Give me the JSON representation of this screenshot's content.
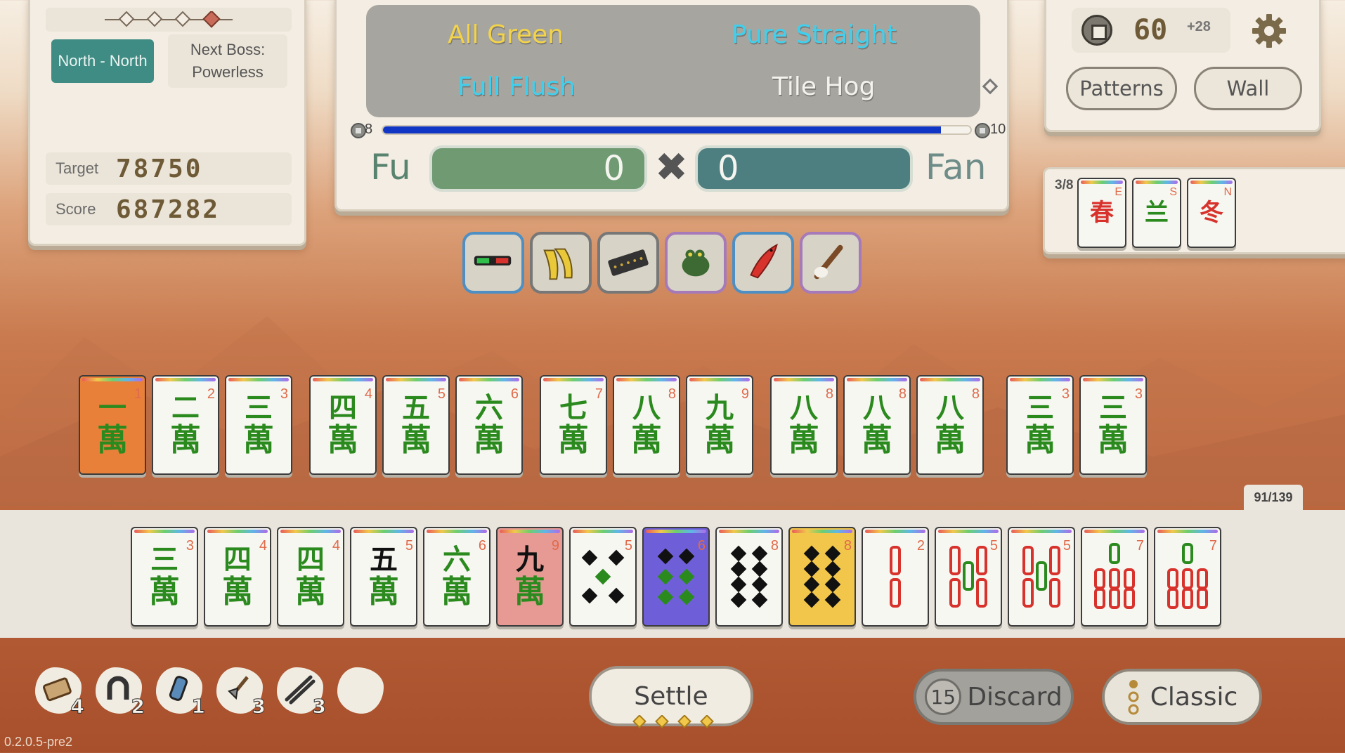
{
  "round": {
    "wind": "North - North",
    "boss_label": "Next Boss:",
    "boss_name": "Powerless",
    "target_label": "Target",
    "target_value": "78750",
    "score_label": "Score",
    "score_value": "687282"
  },
  "yaku": [
    {
      "name": "All Green",
      "color": "#f2d34a"
    },
    {
      "name": "Pure Straight",
      "color": "#3fd0ee"
    },
    {
      "name": "Full Flush",
      "color": "#3fd0ee"
    },
    {
      "name": "Tile Hog",
      "color": "#f4f2ec"
    }
  ],
  "progress": {
    "min_label": "8",
    "max_label": "10",
    "fraction": 0.95,
    "fill_color": "#1136c6"
  },
  "scoring": {
    "fu_label": "Fu",
    "fu_value": "0",
    "times_symbol": "✖",
    "fan_value": "0",
    "fan_label": "Fan",
    "fu_color": "#6f9a72",
    "fan_color": "#4d7f80"
  },
  "wallet": {
    "money": "60",
    "money_plus": "+28",
    "settings_icon": "gear-icon",
    "patterns_label": "Patterns",
    "wall_label": "Wall"
  },
  "flowers": {
    "count": "3/8",
    "tiles": [
      {
        "glyph": "春",
        "corner": "E",
        "icon": "flower-spring-icon"
      },
      {
        "glyph": "兰",
        "corner": "S",
        "icon": "flower-orchid-icon"
      },
      {
        "glyph": "冬",
        "corner": "N",
        "icon": "flower-winter-icon"
      }
    ]
  },
  "relics": [
    {
      "icon": "3d-glasses-icon",
      "border": "#4e8fc3"
    },
    {
      "icon": "banana-peel-icon",
      "border": "#777777"
    },
    {
      "icon": "abacus-icon",
      "border": "#777777"
    },
    {
      "icon": "frog-icon",
      "border": "#a67ab8"
    },
    {
      "icon": "red-fish-icon",
      "border": "#4e8fc3"
    },
    {
      "icon": "brush-icon",
      "border": "#a67ab8"
    }
  ],
  "melds": [
    {
      "char": "一",
      "num": "1",
      "bg": "#e8803a"
    },
    {
      "char": "二",
      "num": "2"
    },
    {
      "char": "三",
      "num": "3"
    },
    {
      "char": "四",
      "num": "4"
    },
    {
      "char": "五",
      "num": "5"
    },
    {
      "char": "六",
      "num": "6"
    },
    {
      "char": "七",
      "num": "7"
    },
    {
      "char": "八",
      "num": "8"
    },
    {
      "char": "九",
      "num": "9"
    },
    {
      "char": "八",
      "num": "8"
    },
    {
      "char": "八",
      "num": "8"
    },
    {
      "char": "八",
      "num": "8"
    },
    {
      "char": "三",
      "num": "3"
    },
    {
      "char": "三",
      "num": "3"
    }
  ],
  "wall_count": "91/139",
  "hand": [
    {
      "kind": "wan",
      "char": "三",
      "num": "3"
    },
    {
      "kind": "wan",
      "char": "四",
      "num": "4"
    },
    {
      "kind": "wan",
      "char": "四",
      "num": "4"
    },
    {
      "kind": "wan",
      "char": "五",
      "num": "5",
      "ink": "#111111"
    },
    {
      "kind": "wan",
      "char": "六",
      "num": "6"
    },
    {
      "kind": "wan",
      "char": "九",
      "num": "9",
      "bg": "#e79a94",
      "ink": "#111111"
    },
    {
      "kind": "circle",
      "num": "5"
    },
    {
      "kind": "circle",
      "num": "6",
      "bg": "#6e5fd8"
    },
    {
      "kind": "circle",
      "num": "8"
    },
    {
      "kind": "circle",
      "num": "8",
      "bg": "#f1c64a"
    },
    {
      "kind": "bamboo",
      "num": "2"
    },
    {
      "kind": "bamboo",
      "num": "5"
    },
    {
      "kind": "bamboo",
      "num": "5"
    },
    {
      "kind": "bamboo",
      "num": "7"
    },
    {
      "kind": "bamboo",
      "num": "7"
    }
  ],
  "tools": [
    {
      "icon": "scroll-icon",
      "count": "4"
    },
    {
      "icon": "horseshoe-icon",
      "count": "2"
    },
    {
      "icon": "bottle-icon",
      "count": "1"
    },
    {
      "icon": "shovel-icon",
      "count": "3"
    },
    {
      "icon": "tongs-icon",
      "count": "3"
    },
    {
      "icon": "empty-slot-icon",
      "count": ""
    }
  ],
  "actions": {
    "settle_label": "Settle",
    "discard_count": "15",
    "discard_label": "Discard",
    "classic_label": "Classic"
  },
  "version": "0.2.0.5-pre2"
}
